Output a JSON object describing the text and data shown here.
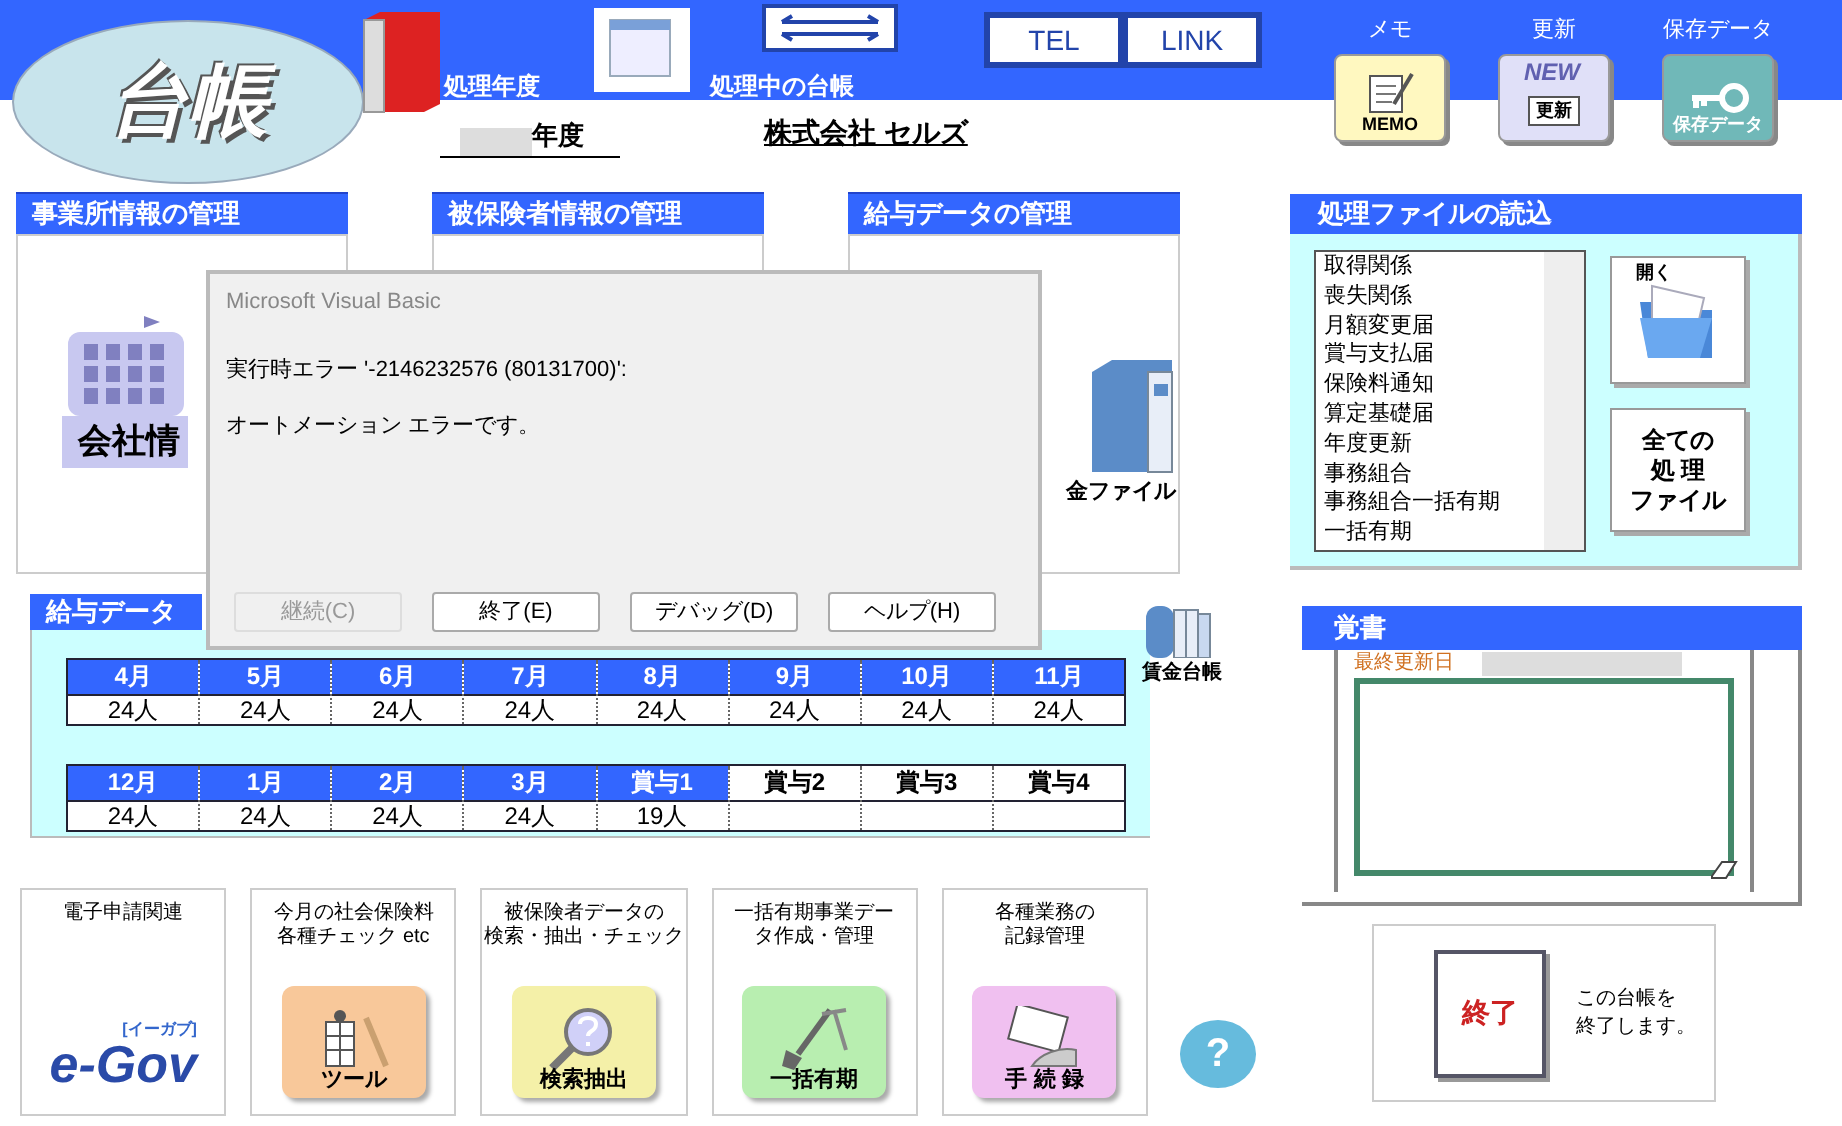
{
  "app_title": "台帳",
  "header": {
    "year_label": "処理年度",
    "ledger_label": "処理中の台帳",
    "year_suffix": "年度",
    "company": "株式会社 セルズ",
    "buttons": [
      "TEL",
      "LINK"
    ],
    "tools": [
      {
        "caption": "メモ",
        "label": "MEMO",
        "kind": "memo"
      },
      {
        "caption": "更新",
        "label": "更新",
        "badge": "NEW",
        "kind": "update"
      },
      {
        "caption": "保存データ",
        "label": "保存データ",
        "kind": "save"
      }
    ]
  },
  "sections": [
    {
      "title": "事業所情報の管理",
      "label": "会社情",
      "kind": "company"
    },
    {
      "title": "被保険者情報の管理",
      "kind": "empty"
    },
    {
      "title": "給与データの管理",
      "label": "金ファイル",
      "kind": "file"
    }
  ],
  "salary": {
    "title": "給与データ",
    "side_label": "賃金台帳",
    "rows": [
      [
        {
          "label": "4月",
          "count": "24人",
          "filled": true
        },
        {
          "label": "5月",
          "count": "24人",
          "filled": true
        },
        {
          "label": "6月",
          "count": "24人",
          "filled": true
        },
        {
          "label": "7月",
          "count": "24人",
          "filled": true
        },
        {
          "label": "8月",
          "count": "24人",
          "filled": true
        },
        {
          "label": "9月",
          "count": "24人",
          "filled": true
        },
        {
          "label": "10月",
          "count": "24人",
          "filled": true
        },
        {
          "label": "11月",
          "count": "24人",
          "filled": true
        }
      ],
      [
        {
          "label": "12月",
          "count": "24人",
          "filled": true
        },
        {
          "label": "1月",
          "count": "24人",
          "filled": true
        },
        {
          "label": "2月",
          "count": "24人",
          "filled": true
        },
        {
          "label": "3月",
          "count": "24人",
          "filled": true
        },
        {
          "label": "賞与1",
          "count": "19人",
          "filled": true
        },
        {
          "label": "賞与2",
          "filled": false
        },
        {
          "label": "賞与3",
          "filled": false
        },
        {
          "label": "賞与4",
          "filled": false
        }
      ]
    ]
  },
  "file_panel": {
    "title": "処理ファイルの読込",
    "files": [
      "取得関係",
      "喪失関係",
      "月額変更届",
      "賞与支払届",
      "保険料通知",
      "算定基礎届",
      "年度更新",
      "事務組合",
      "事務組合一括有期",
      "一括有期"
    ],
    "open_label": "開く",
    "all_label": [
      "全ての",
      "処 理",
      "ファイル"
    ]
  },
  "memo": {
    "title": "覚書",
    "updated_label": "最終更新日"
  },
  "shortcuts": [
    {
      "caption": [
        "電子申請関連"
      ],
      "label": "e-Gov",
      "sub": "[イーガブ]",
      "kind": "egov"
    },
    {
      "caption": [
        "今月の社会保険料",
        "各種チェック etc"
      ],
      "label": "ツール",
      "kind": "tool",
      "color": "#f8c89a"
    },
    {
      "caption": [
        "被保険者データの",
        "検索・抽出・チェック"
      ],
      "label": "検索抽出",
      "kind": "search",
      "color": "#f4f0a8"
    },
    {
      "caption": [
        "一括有期事業デー",
        "タ作成・管理"
      ],
      "label": "一括有期",
      "kind": "shovel",
      "color": "#b8eeb0"
    },
    {
      "caption": [
        "各種業務の",
        "記録管理"
      ],
      "label": "手 続 録",
      "kind": "record",
      "color": "#f0c0f0"
    }
  ],
  "help": "?",
  "exit": {
    "label": "終了",
    "note": [
      "この台帳を",
      "終了します。"
    ]
  },
  "dialog": {
    "title": "Microsoft Visual Basic",
    "message": "実行時エラー '-2146232576 (80131700)':",
    "detail": "オートメーション エラーです。",
    "buttons": [
      {
        "label": "継続(C)",
        "disabled": true
      },
      {
        "label": "終了(E)",
        "disabled": false
      },
      {
        "label": "デバッグ(D)",
        "disabled": false
      },
      {
        "label": "ヘルプ(H)",
        "disabled": false
      }
    ]
  }
}
